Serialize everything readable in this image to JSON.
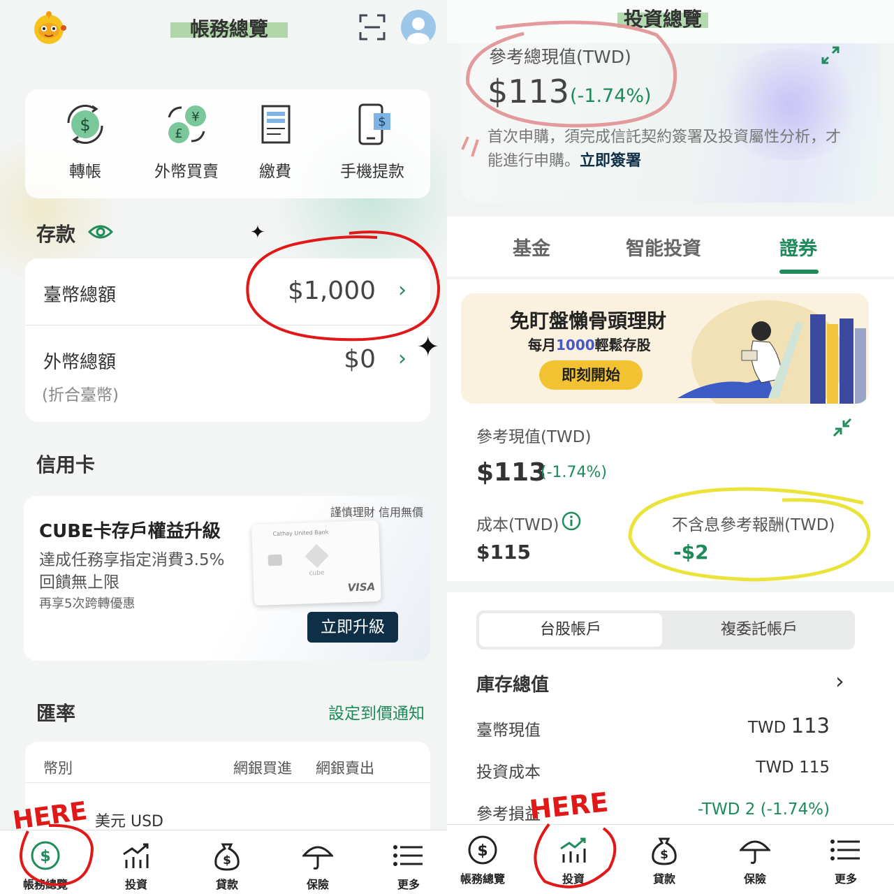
{
  "left": {
    "header_title": "帳務總覽",
    "quick_actions": [
      {
        "label": "轉帳",
        "icon": "transfer-icon"
      },
      {
        "label": "外幣買賣",
        "icon": "currency-exchange-icon"
      },
      {
        "label": "繳費",
        "icon": "bill-icon"
      },
      {
        "label": "手機提款",
        "icon": "mobile-withdraw-icon"
      }
    ],
    "deposit": {
      "title": "存款",
      "twd_label": "臺幣總額",
      "twd_value": "$1,000",
      "fx_label": "外幣總額",
      "fx_sub": "(折合臺幣)",
      "fx_value": "$0"
    },
    "credit": {
      "title": "信用卡",
      "notice": "謹慎理財 信用無價",
      "promo_title": "CUBE卡存戶權益升級",
      "promo_line1": "達成任務享指定消費3.5%",
      "promo_line2": "回饋無上限",
      "promo_line3": "再享5次跨轉優惠",
      "card_bank": "Cathay United Bank",
      "card_brand": "cube",
      "card_network": "VISA",
      "upgrade_label": "立即升級"
    },
    "fx_rate": {
      "title": "匯率",
      "alert_link": "設定到價通知",
      "col_currency": "幣別",
      "col_buy": "網銀買進",
      "col_sell": "網銀賣出",
      "first_currency": "美元 USD"
    },
    "nav": [
      {
        "label": "帳務總覽",
        "icon": "dollar-circle-icon",
        "active": true
      },
      {
        "label": "投資",
        "icon": "investment-chart-icon"
      },
      {
        "label": "貸款",
        "icon": "money-bag-icon"
      },
      {
        "label": "保險",
        "icon": "umbrella-icon"
      },
      {
        "label": "更多",
        "icon": "menu-icon"
      }
    ],
    "annotation": "HERE"
  },
  "right": {
    "header_title": "投資總覽",
    "summary": {
      "label": "參考總現值(TWD)",
      "value": "$113",
      "change": "(-1.74%)",
      "notice": "首次申購，須完成信託契約簽署及投資屬性分析，才能進行申購。",
      "notice_link": "立即簽署"
    },
    "tabs": [
      "基金",
      "智能投資",
      "證券"
    ],
    "active_tab": "證券",
    "banner": {
      "title": "免盯盤懶骨頭理財",
      "subtitle_pre": "每月",
      "subtitle_num": "1000",
      "subtitle_post": "輕鬆存股",
      "cta": "即刻開始"
    },
    "securities": {
      "value_label": "參考現值(TWD)",
      "value": "$113",
      "change": "(-1.74%)",
      "cost_label": "成本(TWD)",
      "cost_value": "$115",
      "return_label": "不含息參考報酬(TWD)",
      "return_value": "-$2"
    },
    "account_tabs": [
      "台股帳戶",
      "複委託帳戶"
    ],
    "inventory": {
      "title": "庫存總值",
      "rows": [
        {
          "label": "臺幣現值",
          "currency": "TWD",
          "value": "113"
        },
        {
          "label": "投資成本",
          "currency": "TWD",
          "value": "115"
        },
        {
          "label": "參考損益",
          "currency": "",
          "value": "-TWD 2 (-1.74%)"
        }
      ]
    },
    "nav": [
      {
        "label": "帳務總覽",
        "icon": "dollar-circle-icon"
      },
      {
        "label": "投資",
        "icon": "investment-chart-icon",
        "active": true
      },
      {
        "label": "貸款",
        "icon": "money-bag-icon"
      },
      {
        "label": "保險",
        "icon": "umbrella-icon"
      },
      {
        "label": "更多",
        "icon": "menu-icon"
      }
    ],
    "annotation": "HERE"
  },
  "colors": {
    "brand_green": "#1d8a5a",
    "annotation_red": "#e01818",
    "annotation_yellow": "#e9e33a",
    "navy_button": "#0e2f45"
  }
}
